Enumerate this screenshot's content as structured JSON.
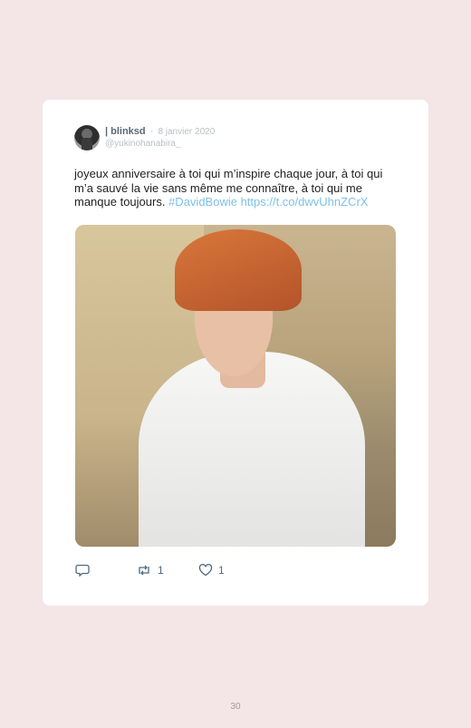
{
  "tweet": {
    "author_name": "| blinksd",
    "separator": "·",
    "date": "8 janvier 2020",
    "handle": "@yukinohanabira_",
    "text": "joyeux anniversaire à toi qui m’inspire chaque jour, à toi qui m’a sauvé la vie sans même me connaître, à toi qui me manque toujours. ",
    "hashtag": "#DavidBowie",
    "link": " https://t.co/dwvUhnZCrX",
    "retweet_count": "1",
    "like_count": "1"
  },
  "icons": {
    "reply": "reply-icon",
    "retweet": "retweet-icon",
    "like": "heart-icon"
  },
  "colors": {
    "page_background": "#f4e6e6",
    "link": "#7cc1e8",
    "icon": "#4d6a80"
  },
  "page": {
    "number": "30"
  }
}
